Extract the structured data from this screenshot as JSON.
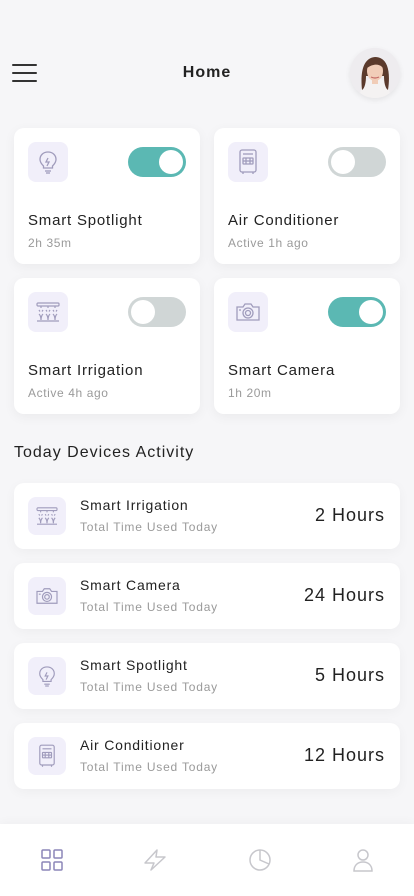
{
  "header": {
    "title": "Home",
    "menu_icon": "hamburger-menu-icon",
    "avatar": "user-avatar"
  },
  "colors": {
    "accent": "#5bb8b3",
    "toggle_off": "#d0d6d6",
    "icon_bg": "#f1effa",
    "icon_stroke": "#a09cbc"
  },
  "devices": [
    {
      "name": "Smart Spotlight",
      "status": "2h 35m",
      "icon": "lightbulb-icon",
      "on": true
    },
    {
      "name": "Air Conditioner",
      "status": "Active 1h ago",
      "icon": "air-conditioner-icon",
      "on": false
    },
    {
      "name": "Smart Irrigation",
      "status": "Active 4h ago",
      "icon": "sprinkler-icon",
      "on": false
    },
    {
      "name": "Smart Camera",
      "status": "1h 20m",
      "icon": "camera-icon",
      "on": true
    }
  ],
  "activity": {
    "title": "Today Devices Activity",
    "items": [
      {
        "name": "Smart Irrigation",
        "sub": "Total Time Used Today",
        "value": "2 Hours",
        "icon": "sprinkler-icon"
      },
      {
        "name": "Smart Camera",
        "sub": "Total Time Used Today",
        "value": "24 Hours",
        "icon": "camera-icon"
      },
      {
        "name": "Smart Spotlight",
        "sub": "Total Time Used Today",
        "value": "5 Hours",
        "icon": "lightbulb-icon"
      },
      {
        "name": "Air Conditioner",
        "sub": "Total Time Used Today",
        "value": "12 Hours",
        "icon": "air-conditioner-icon"
      }
    ]
  },
  "tabbar": {
    "tabs": [
      {
        "icon": "grid-icon",
        "active": true
      },
      {
        "icon": "lightning-icon",
        "active": false
      },
      {
        "icon": "pie-chart-icon",
        "active": false
      },
      {
        "icon": "user-icon",
        "active": false
      }
    ]
  }
}
